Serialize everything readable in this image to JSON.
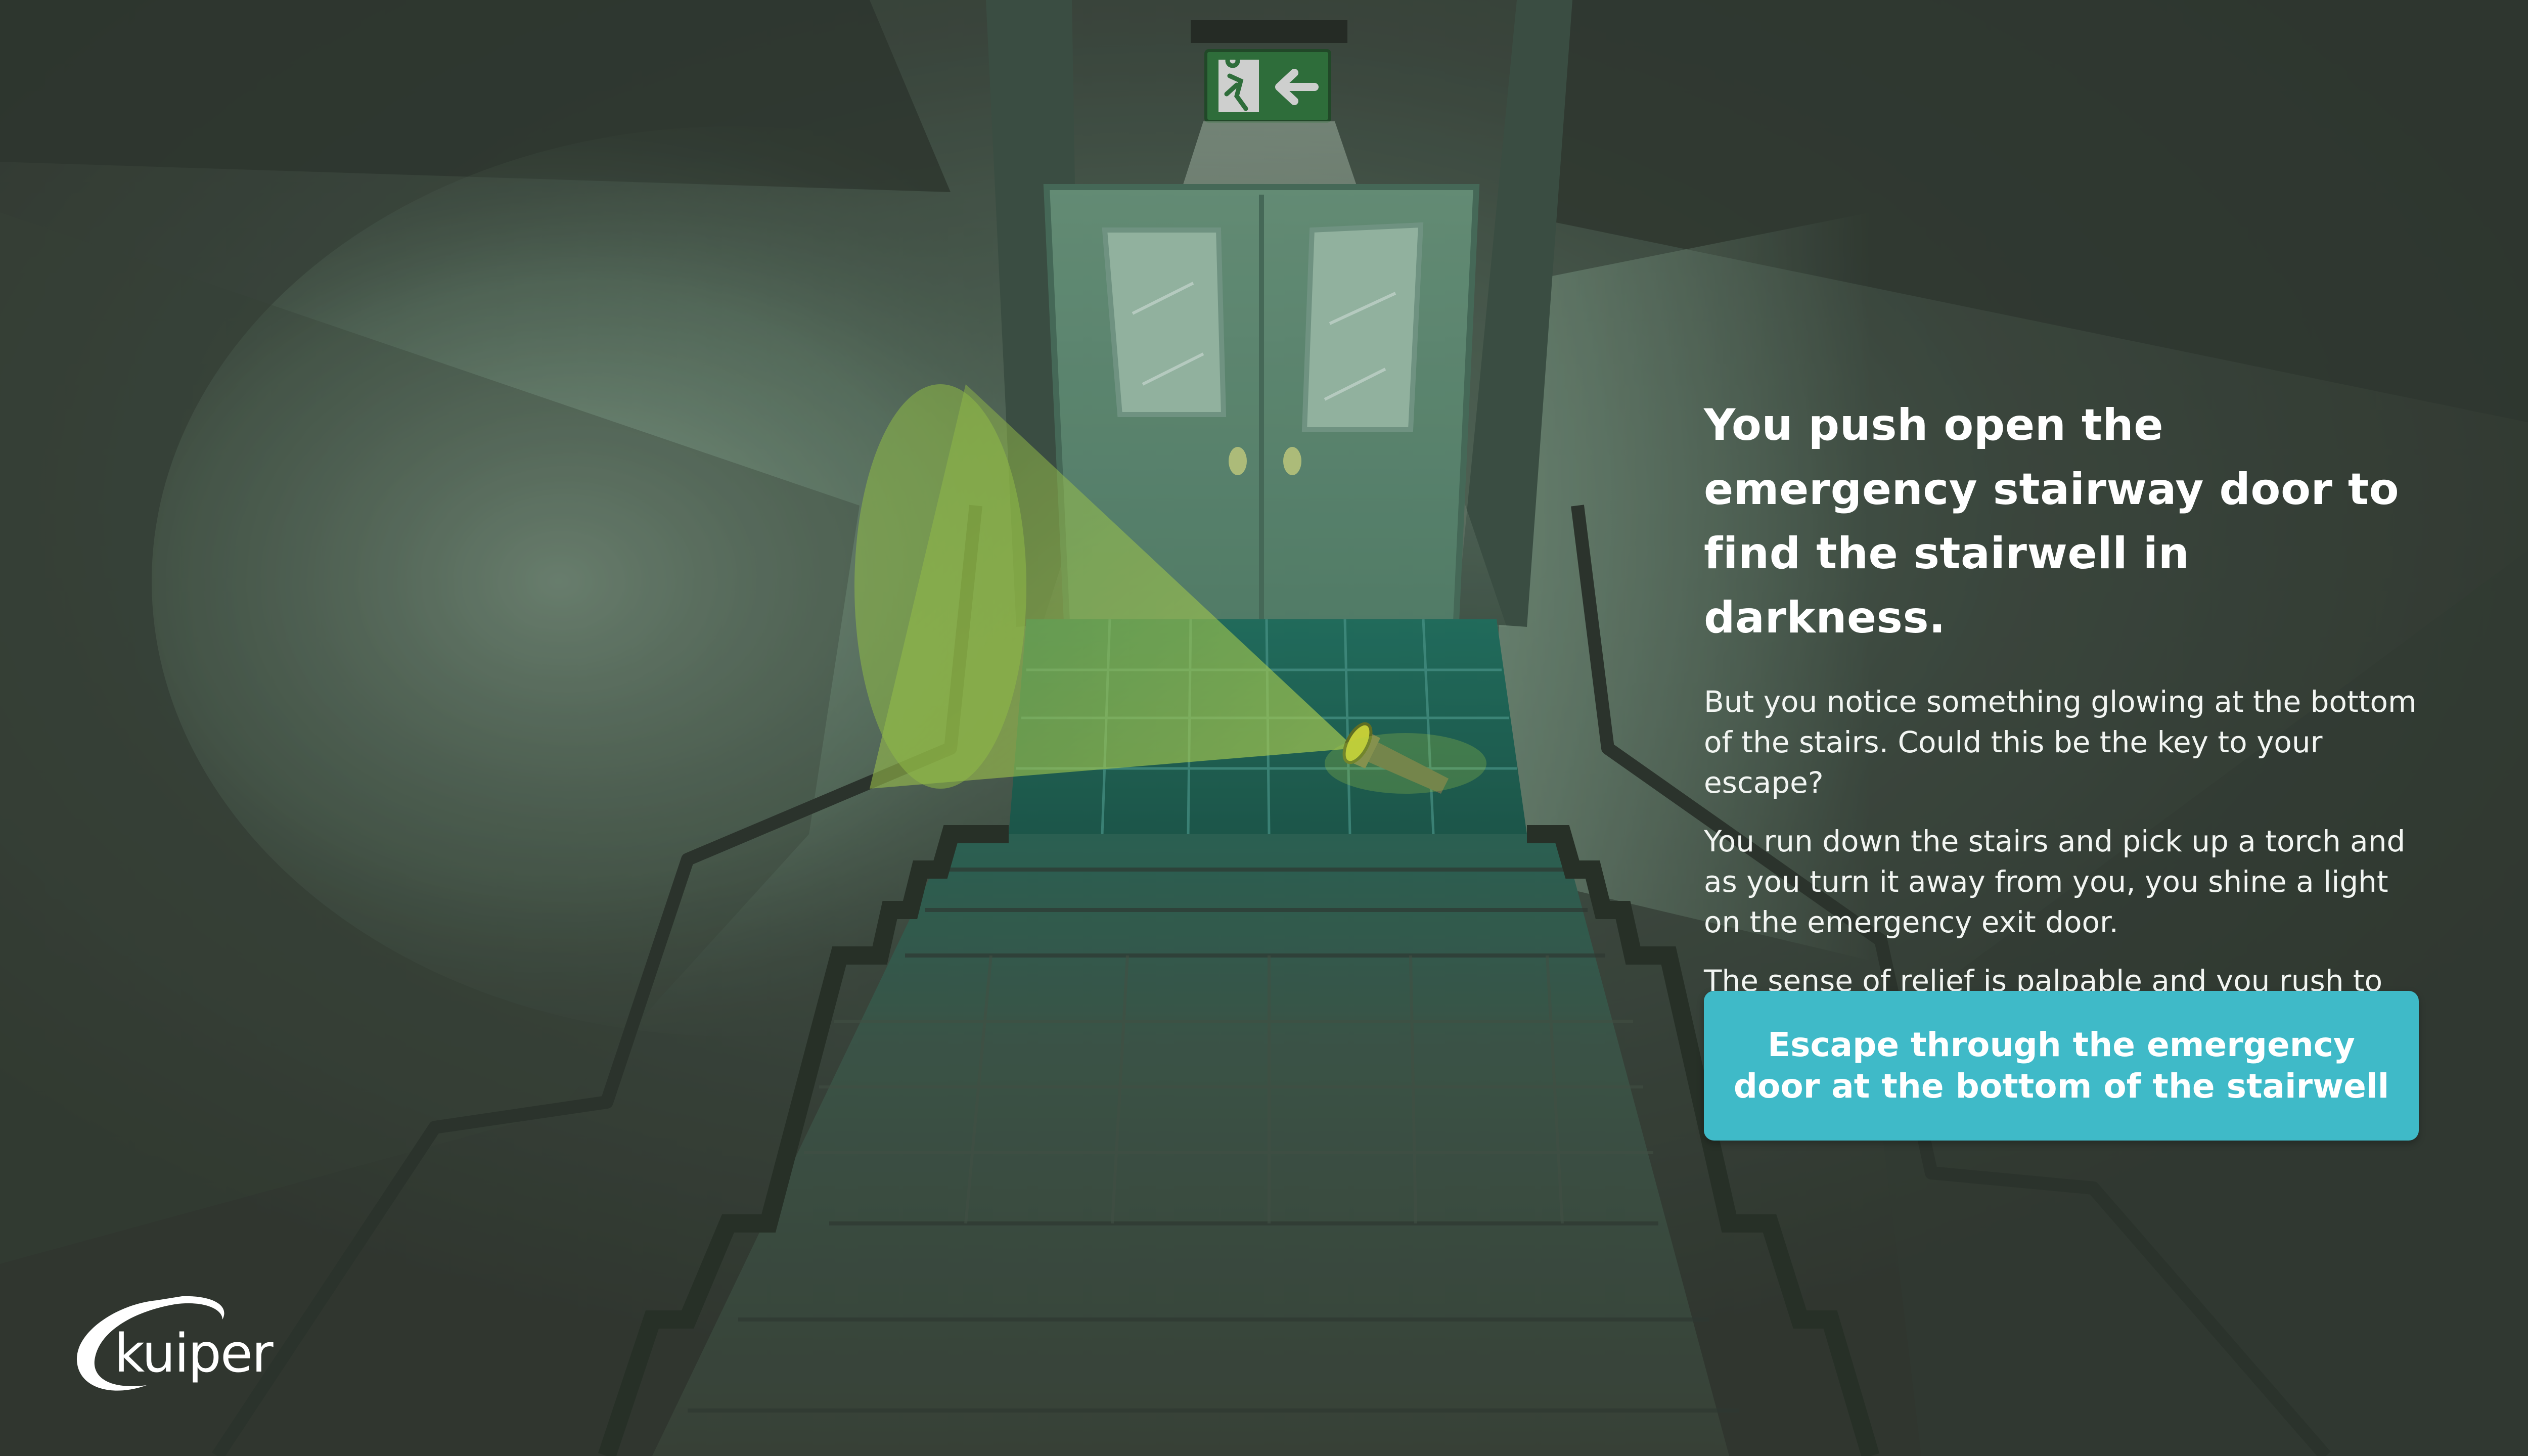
{
  "story": {
    "title": "You push open the emergency stairway door to find the stairwell in darkness.",
    "paragraphs": [
      "But you notice something glowing at the bottom of the stairs. Could this be the key to your escape?",
      "You run down the stairs and pick up a torch and as you turn it away from you, you shine a light on the emergency exit door.",
      "The sense of relief is palpable and you rush to the door..."
    ]
  },
  "choice": {
    "label": "Escape through the emergency door at the bottom of the stairwell"
  },
  "brand": {
    "logo_text": "kuiper"
  },
  "scene": {
    "exit_sign_icon": "running-man-exit-arrow-left-icon",
    "torch_icon": "glowing-torch-icon"
  },
  "colors": {
    "background": "#323a32",
    "button": "#3fbac8",
    "exit_sign": "#2f7a3e",
    "torch_glow": "#b8e24a",
    "floor": "#1d6e5c"
  }
}
